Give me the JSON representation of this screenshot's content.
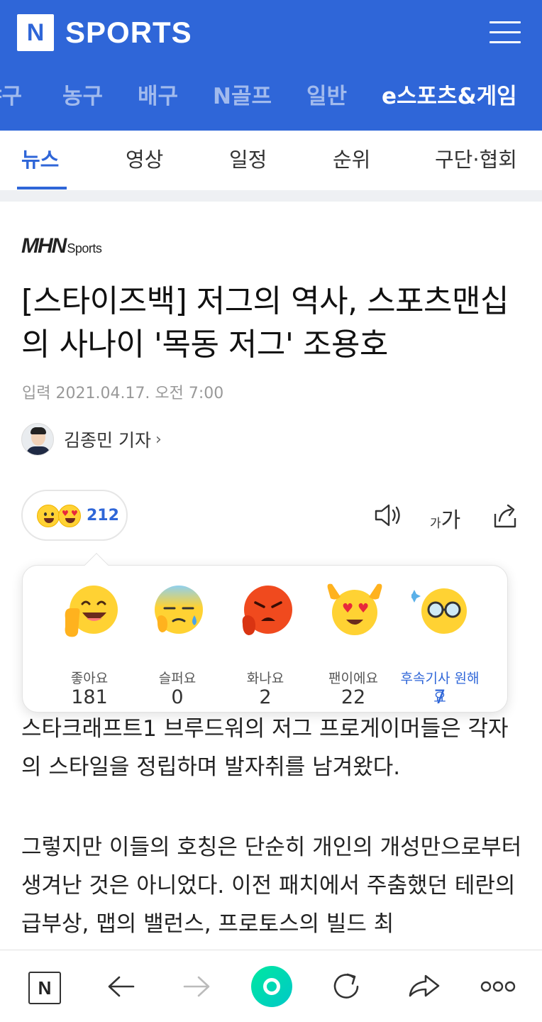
{
  "header": {
    "logo_letter": "N",
    "logo_text": "SPORTS",
    "categories": [
      {
        "label": "야구"
      },
      {
        "label": "농구"
      },
      {
        "label": "배구"
      },
      {
        "label": "N골프"
      },
      {
        "label": "일반"
      },
      {
        "label": "e스포츠&게임"
      }
    ],
    "active_category": "e스포츠&게임",
    "brand_color": "#2f66d8"
  },
  "subtabs": [
    {
      "label": "뉴스"
    },
    {
      "label": "영상"
    },
    {
      "label": "일정"
    },
    {
      "label": "순위"
    },
    {
      "label": "구단·협회"
    }
  ],
  "article": {
    "press_logo_main": "MHN",
    "press_logo_sub": "Sports",
    "title": "[스타이즈백] 저그의 역사, 스포츠맨십의 사나이 '목동 저그' 조용호",
    "date": "입력 2021.04.17. 오전 7:00",
    "reporter": "김종민 기자",
    "reaction_total": "212",
    "font_tool_small": "가",
    "font_tool_big": "가",
    "paragraphs": [
      "스타크래프트1 브루드워의 저그 프로게이머들은 각자의 스타일을 정립하며 발자취를 남겨왔다.",
      "그렇지만 이들의 호칭은 단순히 개인의 개성만으로부터 생겨난 것은 아니었다. 이전 패치에서 주춤했던 테란의 급부상, 맵의 밸런스, 프로토스의 빌드 최"
    ]
  },
  "reactions": [
    {
      "label": "좋아요",
      "count": "181",
      "icon": "thumbs-up-face-icon"
    },
    {
      "label": "슬퍼요",
      "count": "0",
      "icon": "sad-face-icon"
    },
    {
      "label": "화나요",
      "count": "2",
      "icon": "angry-face-icon"
    },
    {
      "label": "팬이에요",
      "count": "22",
      "icon": "heart-eyes-face-icon"
    },
    {
      "label": "후속기사 원해요",
      "count": "7",
      "icon": "glasses-face-icon"
    }
  ],
  "bottom_bar": {
    "home_letter": "N",
    "icons": [
      "home-n-icon",
      "back-arrow-icon",
      "forward-arrow-icon",
      "green-dot-icon",
      "refresh-icon",
      "share-icon",
      "more-icon"
    ]
  }
}
